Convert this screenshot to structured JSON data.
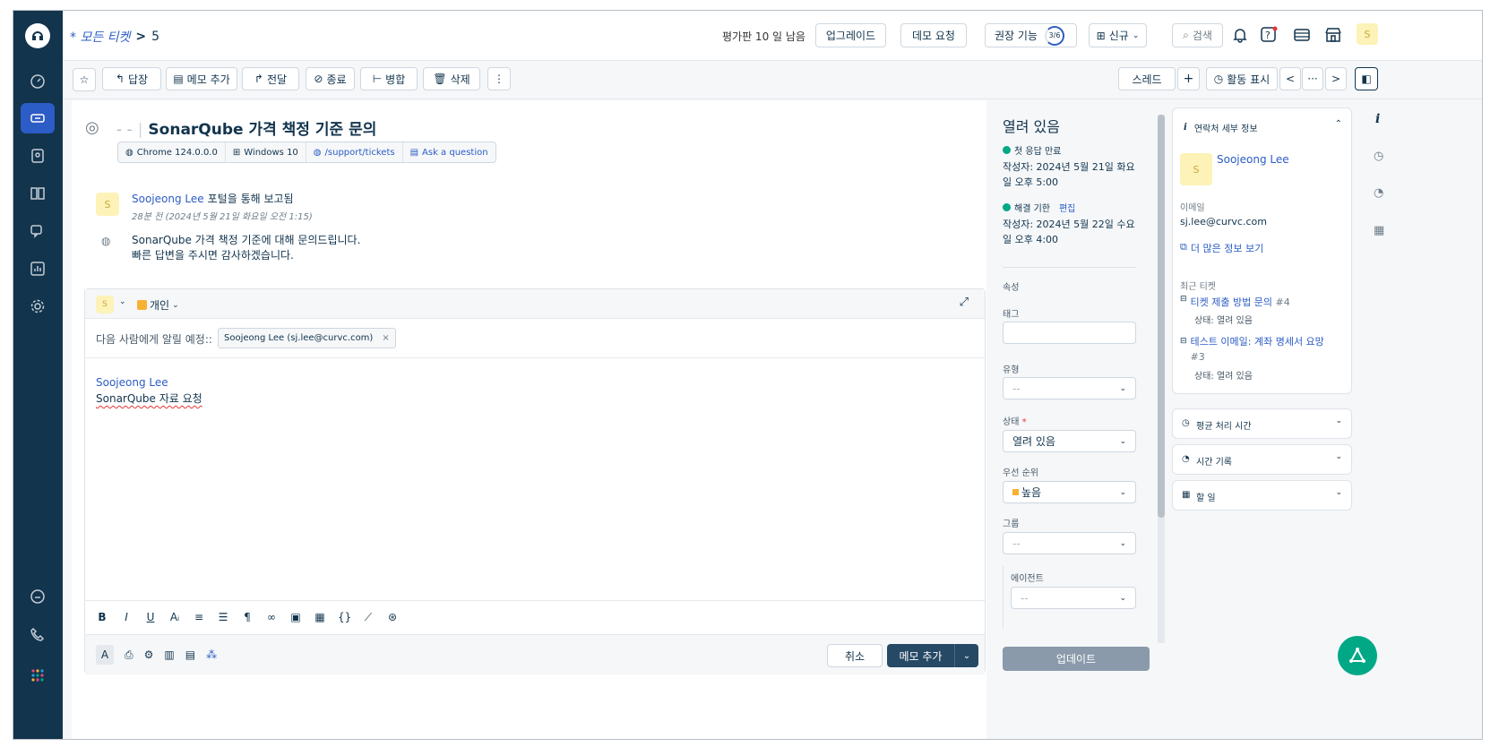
{
  "breadcrumb": {
    "link": "* 모든 티켓",
    "sep": ">",
    "num": "5"
  },
  "top": {
    "trial": "평가판 10 일 남음",
    "upgrade": "업그레이드",
    "demo": "데모 요청",
    "features": "권장 기능",
    "features_progress": "3/6",
    "new": "신규",
    "search": "검색",
    "avatar": "S"
  },
  "toolbar": {
    "reply": "답장",
    "note": "메모 추가",
    "forward": "전달",
    "close": "종료",
    "merge": "병합",
    "delete": "삭제",
    "more": "⋮",
    "thread": "스레드",
    "plus": "+",
    "activity": "활동 표시",
    "prev": "<",
    "dots": "···",
    "next": ">"
  },
  "ticket": {
    "dash": "- -",
    "subject": "SonarQube 가격 책정 기준 문의",
    "meta": [
      {
        "icon": "◍",
        "text": "Chrome 124.0.0.0"
      },
      {
        "icon": "⊞",
        "text": "Windows 10"
      },
      {
        "icon": "◍",
        "text": "/support/tickets",
        "link": true
      },
      {
        "icon": "▤",
        "text": "Ask a question",
        "link": true
      }
    ]
  },
  "message": {
    "avatar": "S",
    "author": "Soojeong Lee",
    "via": "포털을 통해 보고됨",
    "time": "28분 전 (2024년 5월 21일 화요일 오전 1:15)",
    "line1": "SonarQube 가격 책정 기준에 대해 문의드립니다.",
    "line2": "빠른 답변을 주시면 감사하겠습니다."
  },
  "editor": {
    "avatar": "S",
    "privacy": "개인",
    "notify_label": "다음 사람에게 알릴 예정::",
    "chip": "Soojeong Lee (sj.lee@curvc.com)",
    "chip_x": "×",
    "mention": "Soojeong Lee",
    "body": "SonarQube 자료 요청",
    "cancel": "취소",
    "submit": "메모 추가"
  },
  "props": {
    "status_title": "열려 있음",
    "first_resp": "첫 응답 만료",
    "first_resp_date": "작성자: 2024년 5월 21일 화요일 오후 5:00",
    "resolve": "해결 기한",
    "edit": "편집",
    "resolve_date": "작성자: 2024년 5월 22일 수요일 오후 4:00",
    "attrs": "속성",
    "tag": "태그",
    "type": "유형",
    "type_val": "--",
    "state": "상태",
    "req": "*",
    "state_val": "열려 있음",
    "priority": "우선 순위",
    "priority_val": "높음",
    "group": "그룹",
    "group_val": "--",
    "agent": "에이전트",
    "agent_val": "--",
    "update": "업데이트"
  },
  "contact": {
    "title": "연락처 세부 정보",
    "avatar": "S",
    "name": "Soojeong Lee",
    "email_label": "이메일",
    "email": "sj.lee@curvc.com",
    "more": "더 많은 정보 보기",
    "recent": "최근 티켓",
    "t1": "티켓 제출 방법 문의",
    "t1num": "#4",
    "t1status": "상태: 열려 있음",
    "t2": "테스트 이메일: 계좌 명세서 요망",
    "t2num": "#3",
    "t2status": "상태: 열려 있음",
    "avg": "평균 처리 시간",
    "timelog": "시간 기록",
    "todo": "할 일"
  },
  "colors": {
    "nav": "#12344d",
    "accent": "#2c5cc5",
    "primary": "#264966",
    "green": "#00a886"
  }
}
